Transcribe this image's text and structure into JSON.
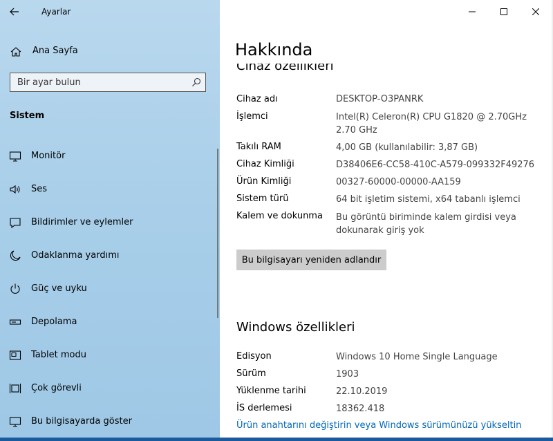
{
  "window": {
    "title": "Ayarlar",
    "minimize_glyph": "—",
    "maximize_glyph": "☐",
    "close_glyph": "✕"
  },
  "sidebar": {
    "home_label": "Ana Sayfa",
    "search_placeholder": "Bir ayar bulun",
    "section_title": "Sistem",
    "items": [
      {
        "label": "Monitör",
        "icon": "monitor-icon"
      },
      {
        "label": "Ses",
        "icon": "speaker-icon"
      },
      {
        "label": "Bildirimler ve eylemler",
        "icon": "notification-icon"
      },
      {
        "label": "Odaklanma yardımı",
        "icon": "moon-icon"
      },
      {
        "label": "Güç ve uyku",
        "icon": "power-icon"
      },
      {
        "label": "Depolama",
        "icon": "storage-icon"
      },
      {
        "label": "Tablet modu",
        "icon": "tablet-icon"
      },
      {
        "label": "Çok görevli",
        "icon": "multitask-icon"
      },
      {
        "label": "Bu bilgisayarda göster",
        "icon": "project-icon"
      }
    ]
  },
  "main": {
    "title": "Hakkında",
    "device_specs": {
      "heading": "Cihaz özellikleri",
      "rows": [
        {
          "key": "Cihaz adı",
          "value": "DESKTOP-O3PANRK"
        },
        {
          "key": "İşlemci",
          "value": "Intel(R) Celeron(R) CPU G1820 @ 2.70GHz",
          "value2": "2.70 GHz"
        },
        {
          "key": "Takılı RAM",
          "value": "4,00 GB (kullanılabilir: 3,87 GB)"
        },
        {
          "key": "Cihaz Kimliği",
          "value": "D38406E6-CC58-410C-A579-099332F49276"
        },
        {
          "key": "Ürün Kimliği",
          "value": "00327-60000-00000-AA159"
        },
        {
          "key": "Sistem türü",
          "value": "64 bit işletim sistemi, x64 tabanlı işlemci"
        },
        {
          "key": "Kalem ve dokunma",
          "value": "Bu görüntü biriminde kalem girdisi veya",
          "value2": "dokunarak giriş yok"
        }
      ],
      "rename_button": "Bu bilgisayarı yeniden adlandır"
    },
    "windows_specs": {
      "heading": "Windows özellikleri",
      "rows": [
        {
          "key": "Edisyon",
          "value": "Windows 10 Home Single Language"
        },
        {
          "key": "Sürüm",
          "value": "1903"
        },
        {
          "key": "Yüklenme tarihi",
          "value": "22.10.2019"
        },
        {
          "key": "İS derlemesi",
          "value": "18362.418"
        }
      ],
      "link": "Ürün anahtarını değiştirin veya Windows sürümünüzü yükseltin"
    }
  }
}
